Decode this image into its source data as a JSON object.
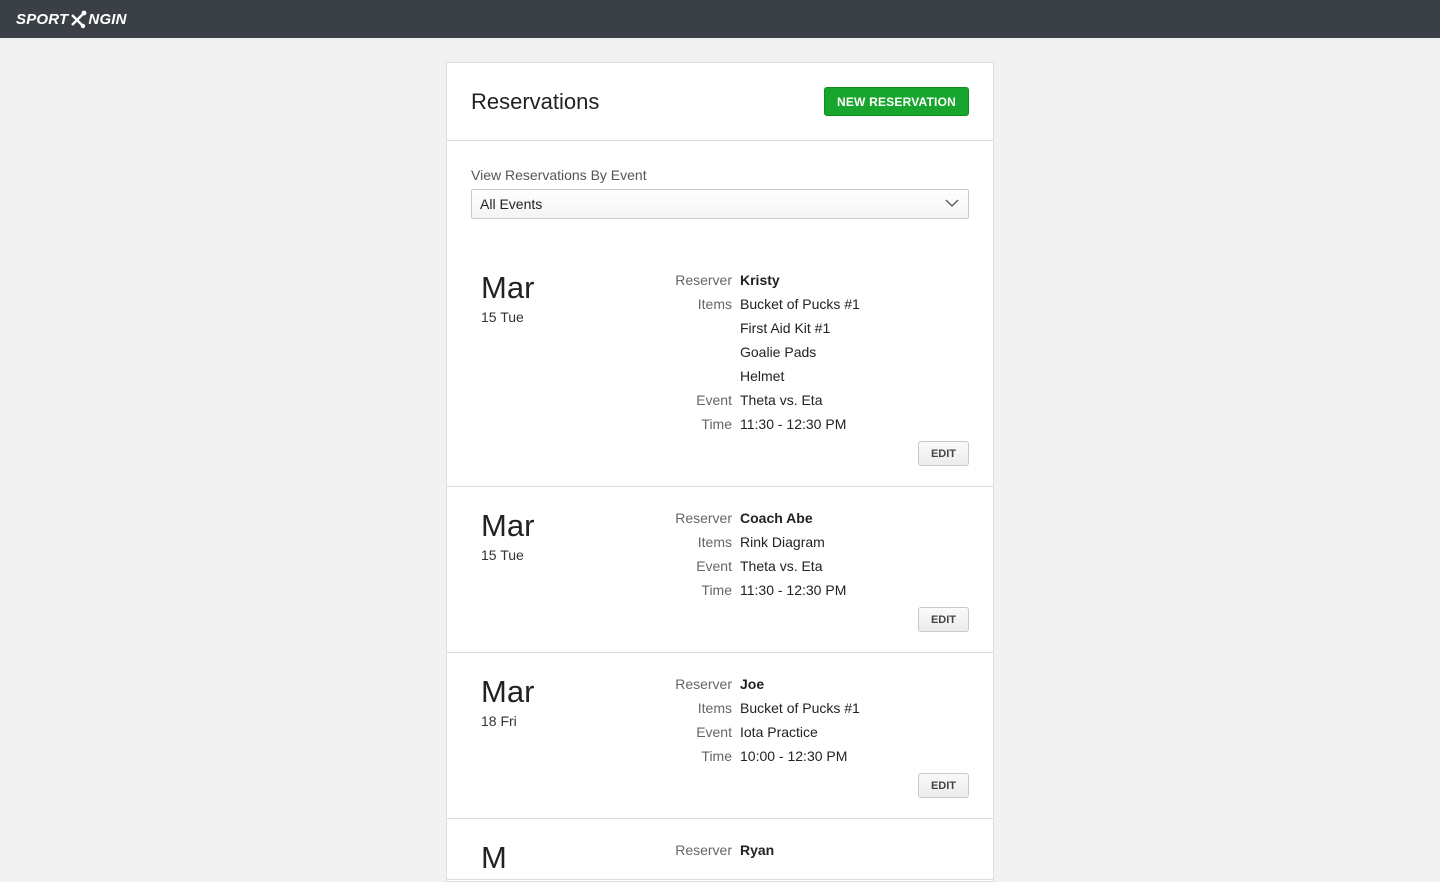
{
  "brand": {
    "logo_left": "SPORT",
    "logo_right": "NGIN"
  },
  "page": {
    "title": "Reservations",
    "new_button": "NEW RESERVATION"
  },
  "filter": {
    "label": "View Reservations By Event",
    "selected": "All Events"
  },
  "labels": {
    "reserver": "Reserver",
    "items": "Items",
    "event": "Event",
    "time": "Time",
    "edit": "EDIT"
  },
  "reservations": [
    {
      "month": "Mar",
      "day": "15 Tue",
      "reserver": "Kristy",
      "items": [
        "Bucket of Pucks #1",
        "First Aid Kit #1",
        "Goalie Pads",
        "Helmet"
      ],
      "event": "Theta vs. Eta",
      "time": "11:30 - 12:30 PM"
    },
    {
      "month": "Mar",
      "day": "15 Tue",
      "reserver": "Coach Abe",
      "items": [
        "Rink Diagram"
      ],
      "event": "Theta vs. Eta",
      "time": "11:30 - 12:30 PM"
    },
    {
      "month": "Mar",
      "day": "18 Fri",
      "reserver": "Joe",
      "items": [
        "Bucket of Pucks #1"
      ],
      "event": "Iota Practice",
      "time": "10:00 - 12:30 PM"
    },
    {
      "month": "M",
      "day": "",
      "reserver": "Ryan",
      "items": [],
      "event": "",
      "time": ""
    }
  ],
  "colors": {
    "topbar": "#3a4046",
    "primary_button": "#17a52d",
    "background": "#f1f1f1"
  }
}
